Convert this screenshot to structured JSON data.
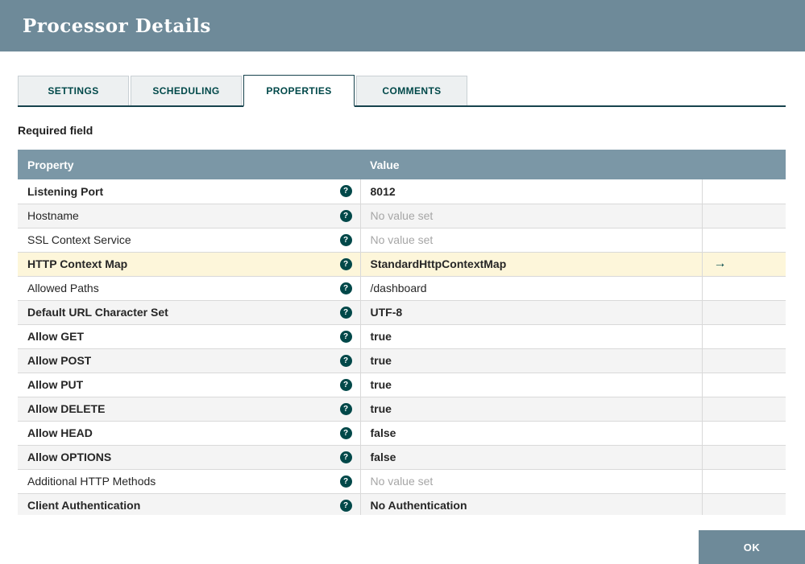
{
  "header": {
    "title": "Processor Details"
  },
  "tabs": [
    {
      "label": "SETTINGS",
      "active": false
    },
    {
      "label": "SCHEDULING",
      "active": false
    },
    {
      "label": "PROPERTIES",
      "active": true
    },
    {
      "label": "COMMENTS",
      "active": false
    }
  ],
  "required_field_note": "Required field",
  "table": {
    "columns": [
      "Property",
      "Value"
    ],
    "rows": [
      {
        "property": "Listening Port",
        "value": "8012",
        "required": true,
        "no_value": false,
        "highlighted": false,
        "has_goto": false
      },
      {
        "property": "Hostname",
        "value": "No value set",
        "required": false,
        "no_value": true,
        "highlighted": false,
        "has_goto": false
      },
      {
        "property": "SSL Context Service",
        "value": "No value set",
        "required": false,
        "no_value": true,
        "highlighted": false,
        "has_goto": false
      },
      {
        "property": "HTTP Context Map",
        "value": "StandardHttpContextMap",
        "required": true,
        "no_value": false,
        "highlighted": true,
        "has_goto": true
      },
      {
        "property": "Allowed Paths",
        "value": "/dashboard",
        "required": false,
        "no_value": false,
        "highlighted": false,
        "has_goto": false
      },
      {
        "property": "Default URL Character Set",
        "value": "UTF-8",
        "required": true,
        "no_value": false,
        "highlighted": false,
        "has_goto": false
      },
      {
        "property": "Allow GET",
        "value": "true",
        "required": true,
        "no_value": false,
        "highlighted": false,
        "has_goto": false
      },
      {
        "property": "Allow POST",
        "value": "true",
        "required": true,
        "no_value": false,
        "highlighted": false,
        "has_goto": false
      },
      {
        "property": "Allow PUT",
        "value": "true",
        "required": true,
        "no_value": false,
        "highlighted": false,
        "has_goto": false
      },
      {
        "property": "Allow DELETE",
        "value": "true",
        "required": true,
        "no_value": false,
        "highlighted": false,
        "has_goto": false
      },
      {
        "property": "Allow HEAD",
        "value": "false",
        "required": true,
        "no_value": false,
        "highlighted": false,
        "has_goto": false
      },
      {
        "property": "Allow OPTIONS",
        "value": "false",
        "required": true,
        "no_value": false,
        "highlighted": false,
        "has_goto": false
      },
      {
        "property": "Additional HTTP Methods",
        "value": "No value set",
        "required": false,
        "no_value": true,
        "highlighted": false,
        "has_goto": false
      },
      {
        "property": "Client Authentication",
        "value": "No Authentication",
        "required": true,
        "no_value": false,
        "highlighted": false,
        "has_goto": false
      }
    ]
  },
  "footer": {
    "ok_label": "OK"
  },
  "icons": {
    "help": "?",
    "goto": "→"
  },
  "colors": {
    "header_bg": "#6e8a99",
    "table_header_bg": "#7b97a6",
    "accent": "#004849",
    "accent_dark": "#17434d",
    "highlight_row": "#fdf6da",
    "unset_text": "#a6a6a6"
  }
}
